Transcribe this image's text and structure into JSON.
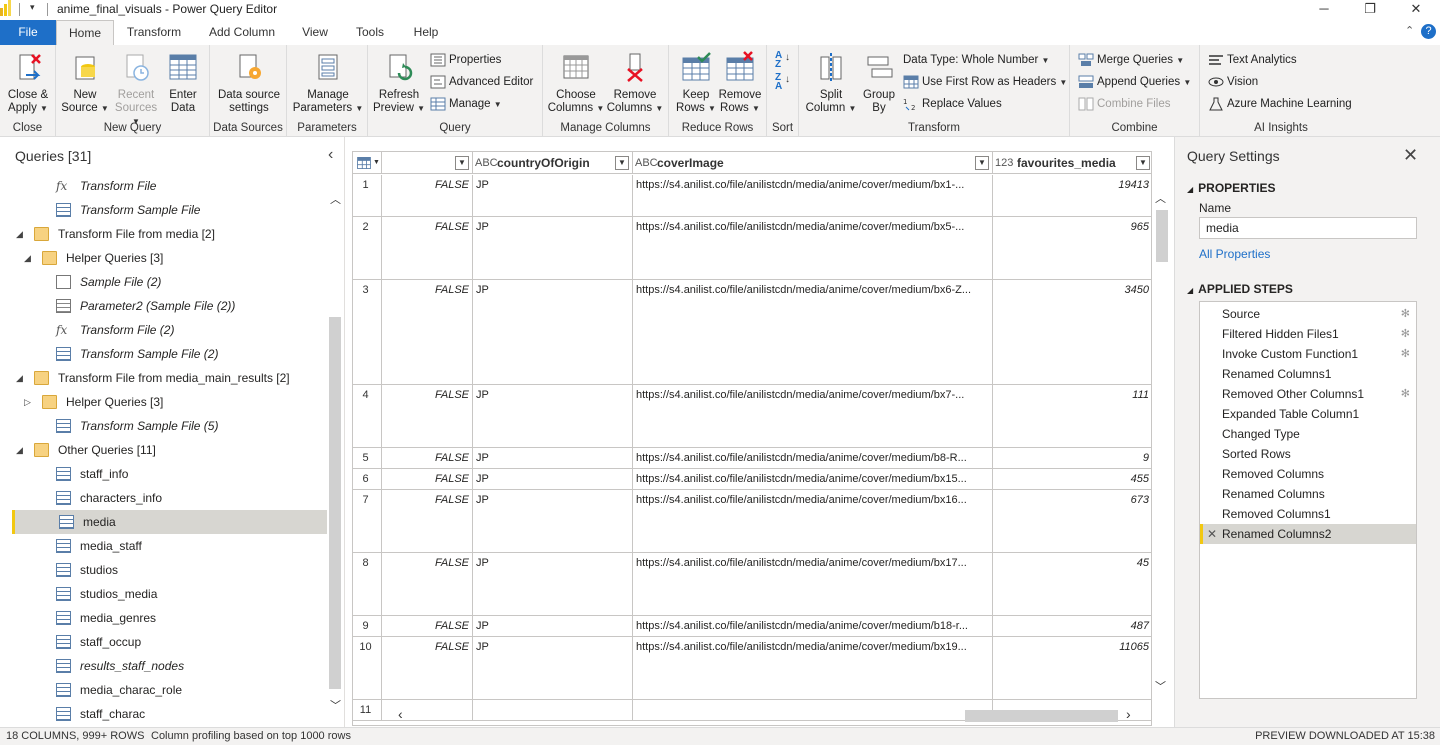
{
  "window": {
    "title": "anime_final_visuals - Power Query Editor",
    "minimize": "─",
    "maximize": "❐",
    "close": "✕"
  },
  "tabs": [
    "File",
    "Home",
    "Transform",
    "Add Column",
    "View",
    "Tools",
    "Help"
  ],
  "ribbon": {
    "close_apply": [
      "Close &",
      "Apply"
    ],
    "new_source": [
      "New",
      "Source"
    ],
    "recent_sources": [
      "Recent",
      "Sources"
    ],
    "enter_data": [
      "Enter",
      "Data"
    ],
    "data_source_settings": [
      "Data source",
      "settings"
    ],
    "manage_parameters": [
      "Manage",
      "Parameters"
    ],
    "refresh_preview": [
      "Refresh",
      "Preview"
    ],
    "properties": "Properties",
    "advanced_editor": "Advanced Editor",
    "manage": "Manage",
    "choose_columns": [
      "Choose",
      "Columns"
    ],
    "remove_columns": [
      "Remove",
      "Columns"
    ],
    "keep_rows": [
      "Keep",
      "Rows"
    ],
    "remove_rows": [
      "Remove",
      "Rows"
    ],
    "split_column": [
      "Split",
      "Column"
    ],
    "group_by": [
      "Group",
      "By"
    ],
    "data_type": "Data Type: Whole Number",
    "use_first_row": "Use First Row as Headers",
    "replace_values": "Replace Values",
    "merge_queries": "Merge Queries",
    "append_queries": "Append Queries",
    "combine_files": "Combine Files",
    "text_analytics": "Text Analytics",
    "vision": "Vision",
    "azure_ml": "Azure Machine Learning",
    "groups": [
      "Close",
      "New Query",
      "Data Sources",
      "Parameters",
      "Query",
      "Manage Columns",
      "Reduce Rows",
      "Sort",
      "Transform",
      "Combine",
      "AI Insights"
    ]
  },
  "queries": {
    "header": "Queries [31]",
    "items": [
      {
        "label": "Transform File",
        "icon": "fx",
        "italic": true,
        "indent": 2,
        "tri": ""
      },
      {
        "label": "Transform Sample File",
        "icon": "table",
        "italic": true,
        "indent": 2,
        "tri": ""
      },
      {
        "label": "Transform File from media [2]",
        "icon": "folder",
        "italic": false,
        "indent": 0,
        "tri": "◢"
      },
      {
        "label": "Helper Queries [3]",
        "icon": "folder",
        "italic": false,
        "indent": 1,
        "tri": "◢"
      },
      {
        "label": "Sample File (2)",
        "icon": "doc",
        "italic": true,
        "indent": 2,
        "tri": ""
      },
      {
        "label": "Parameter2 (Sample File (2))",
        "icon": "param",
        "italic": true,
        "indent": 2,
        "tri": ""
      },
      {
        "label": "Transform File (2)",
        "icon": "fx",
        "italic": true,
        "indent": 2,
        "tri": ""
      },
      {
        "label": "Transform Sample File (2)",
        "icon": "table",
        "italic": true,
        "indent": 2,
        "tri": ""
      },
      {
        "label": "Transform File from media_main_results [2]",
        "icon": "folder",
        "italic": false,
        "indent": 0,
        "tri": "◢"
      },
      {
        "label": "Helper Queries [3]",
        "icon": "folder",
        "italic": false,
        "indent": 1,
        "tri": "▷"
      },
      {
        "label": "Transform Sample File (5)",
        "icon": "table",
        "italic": true,
        "indent": 2,
        "tri": ""
      },
      {
        "label": "Other Queries [11]",
        "icon": "folder",
        "italic": false,
        "indent": 0,
        "tri": "◢"
      },
      {
        "label": "staff_info",
        "icon": "table",
        "italic": false,
        "indent": 2,
        "tri": ""
      },
      {
        "label": "characters_info",
        "icon": "table",
        "italic": false,
        "indent": 2,
        "tri": ""
      },
      {
        "label": "media",
        "icon": "table",
        "italic": false,
        "indent": 2,
        "tri": "",
        "selected": true
      },
      {
        "label": "media_staff",
        "icon": "table",
        "italic": false,
        "indent": 2,
        "tri": ""
      },
      {
        "label": "studios",
        "icon": "table",
        "italic": false,
        "indent": 2,
        "tri": ""
      },
      {
        "label": "studios_media",
        "icon": "table",
        "italic": false,
        "indent": 2,
        "tri": ""
      },
      {
        "label": "media_genres",
        "icon": "table",
        "italic": false,
        "indent": 2,
        "tri": ""
      },
      {
        "label": "staff_occup",
        "icon": "table",
        "italic": false,
        "indent": 2,
        "tri": ""
      },
      {
        "label": "results_staff_nodes",
        "icon": "table",
        "italic": true,
        "indent": 2,
        "tri": ""
      },
      {
        "label": "media_charac_role",
        "icon": "table",
        "italic": false,
        "indent": 2,
        "tri": ""
      },
      {
        "label": "staff_charac",
        "icon": "table",
        "italic": false,
        "indent": 2,
        "tri": ""
      }
    ]
  },
  "grid": {
    "columns": [
      {
        "type": "",
        "name": ""
      },
      {
        "type": "ABC",
        "name": "countryOfOrigin"
      },
      {
        "type": "ABC",
        "name": "coverImage"
      },
      {
        "type": "123",
        "name": "favourites_media"
      }
    ],
    "rows": [
      {
        "n": "1",
        "bool": "FALSE",
        "country": "JP",
        "cover": "https://s4.anilist.co/file/anilistcdn/media/anime/cover/medium/bx1-...",
        "fav": "19413",
        "h": 42
      },
      {
        "n": "2",
        "bool": "FALSE",
        "country": "JP",
        "cover": "https://s4.anilist.co/file/anilistcdn/media/anime/cover/medium/bx5-...",
        "fav": "965",
        "h": 63
      },
      {
        "n": "3",
        "bool": "FALSE",
        "country": "JP",
        "cover": "https://s4.anilist.co/file/anilistcdn/media/anime/cover/medium/bx6-Z...",
        "fav": "3450",
        "h": 105
      },
      {
        "n": "4",
        "bool": "FALSE",
        "country": "JP",
        "cover": "https://s4.anilist.co/file/anilistcdn/media/anime/cover/medium/bx7-...",
        "fav": "111",
        "h": 63
      },
      {
        "n": "5",
        "bool": "FALSE",
        "country": "JP",
        "cover": "https://s4.anilist.co/file/anilistcdn/media/anime/cover/medium/b8-R...",
        "fav": "9",
        "h": 21
      },
      {
        "n": "6",
        "bool": "FALSE",
        "country": "JP",
        "cover": "https://s4.anilist.co/file/anilistcdn/media/anime/cover/medium/bx15...",
        "fav": "455",
        "h": 21
      },
      {
        "n": "7",
        "bool": "FALSE",
        "country": "JP",
        "cover": "https://s4.anilist.co/file/anilistcdn/media/anime/cover/medium/bx16...",
        "fav": "673",
        "h": 63
      },
      {
        "n": "8",
        "bool": "FALSE",
        "country": "JP",
        "cover": "https://s4.anilist.co/file/anilistcdn/media/anime/cover/medium/bx17...",
        "fav": "45",
        "h": 63
      },
      {
        "n": "9",
        "bool": "FALSE",
        "country": "JP",
        "cover": "https://s4.anilist.co/file/anilistcdn/media/anime/cover/medium/b18-r...",
        "fav": "487",
        "h": 21
      },
      {
        "n": "10",
        "bool": "FALSE",
        "country": "JP",
        "cover": "https://s4.anilist.co/file/anilistcdn/media/anime/cover/medium/bx19...",
        "fav": "11065",
        "h": 63
      },
      {
        "n": "11",
        "bool": "",
        "country": "",
        "cover": "",
        "fav": "",
        "h": 21
      }
    ]
  },
  "settings": {
    "header": "Query Settings",
    "properties": "PROPERTIES",
    "name_label": "Name",
    "name_value": "media",
    "all_properties": "All Properties",
    "applied_steps": "APPLIED STEPS",
    "steps": [
      {
        "label": "Source",
        "gear": true
      },
      {
        "label": "Filtered Hidden Files1",
        "gear": true
      },
      {
        "label": "Invoke Custom Function1",
        "gear": true
      },
      {
        "label": "Renamed Columns1",
        "gear": false
      },
      {
        "label": "Removed Other Columns1",
        "gear": true
      },
      {
        "label": "Expanded Table Column1",
        "gear": false
      },
      {
        "label": "Changed Type",
        "gear": false
      },
      {
        "label": "Sorted Rows",
        "gear": false
      },
      {
        "label": "Removed Columns",
        "gear": false
      },
      {
        "label": "Renamed Columns",
        "gear": false
      },
      {
        "label": "Removed Columns1",
        "gear": false
      },
      {
        "label": "Renamed Columns2",
        "gear": false,
        "selected": true
      }
    ]
  },
  "status": {
    "left": "18 COLUMNS, 999+ ROWS",
    "profiling": "Column profiling based on top 1000 rows",
    "right": "PREVIEW DOWNLOADED AT 15:38"
  },
  "colors": {
    "accent": "#1e6fc8",
    "selection": "#d7d6d1",
    "selection_marker": "#f2c811"
  }
}
